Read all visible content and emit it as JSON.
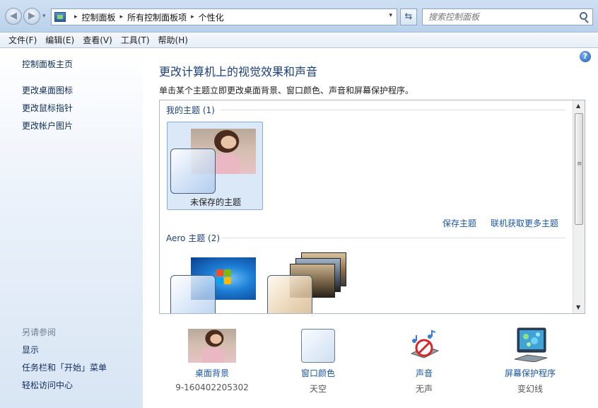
{
  "nav": {
    "back_glyph": "◀",
    "forward_glyph": "▶",
    "refresh_glyph": "⇆"
  },
  "address": {
    "breadcrumbs": [
      "控制面板",
      "所有控制面板项",
      "个性化"
    ],
    "separator": "▸",
    "dropdown_glyph": "▾"
  },
  "search": {
    "placeholder": "搜索控制面板"
  },
  "menu": {
    "items": [
      "文件(F)",
      "编辑(E)",
      "查看(V)",
      "工具(T)",
      "帮助(H)"
    ]
  },
  "sidebar": {
    "home": "控制面板主页",
    "links": [
      "更改桌面图标",
      "更改鼠标指针",
      "更改帐户图片"
    ],
    "see_also_title": "另请参阅",
    "see_also": [
      "显示",
      "任务栏和「开始」菜单",
      "轻松访问中心"
    ]
  },
  "main": {
    "help_glyph": "?",
    "title": "更改计算机上的视觉效果和声音",
    "description": "单击某个主题立即更改桌面背景、窗口颜色、声音和屏幕保护程序。",
    "my_themes_header": "我的主题 (1)",
    "unsaved_theme_label": "未保存的主题",
    "save_theme_link": "保存主题",
    "online_themes_link": "联机获取更多主题",
    "aero_header": "Aero 主题 (2)"
  },
  "scrollbar": {
    "up_glyph": "▲",
    "down_glyph": "▼",
    "grip_glyph": "≡"
  },
  "settings": {
    "desktop_background": {
      "label": "桌面背景",
      "value": "9-160402205302"
    },
    "window_color": {
      "label": "窗口颜色",
      "value": "天空"
    },
    "sounds": {
      "label": "声音",
      "value": "无声"
    },
    "screen_saver": {
      "label": "屏幕保护程序",
      "value": "变幻线"
    }
  },
  "colors": {
    "link": "#1a56a8",
    "title": "#1b3f7a",
    "sidebar_link": "#0f2c5a"
  }
}
